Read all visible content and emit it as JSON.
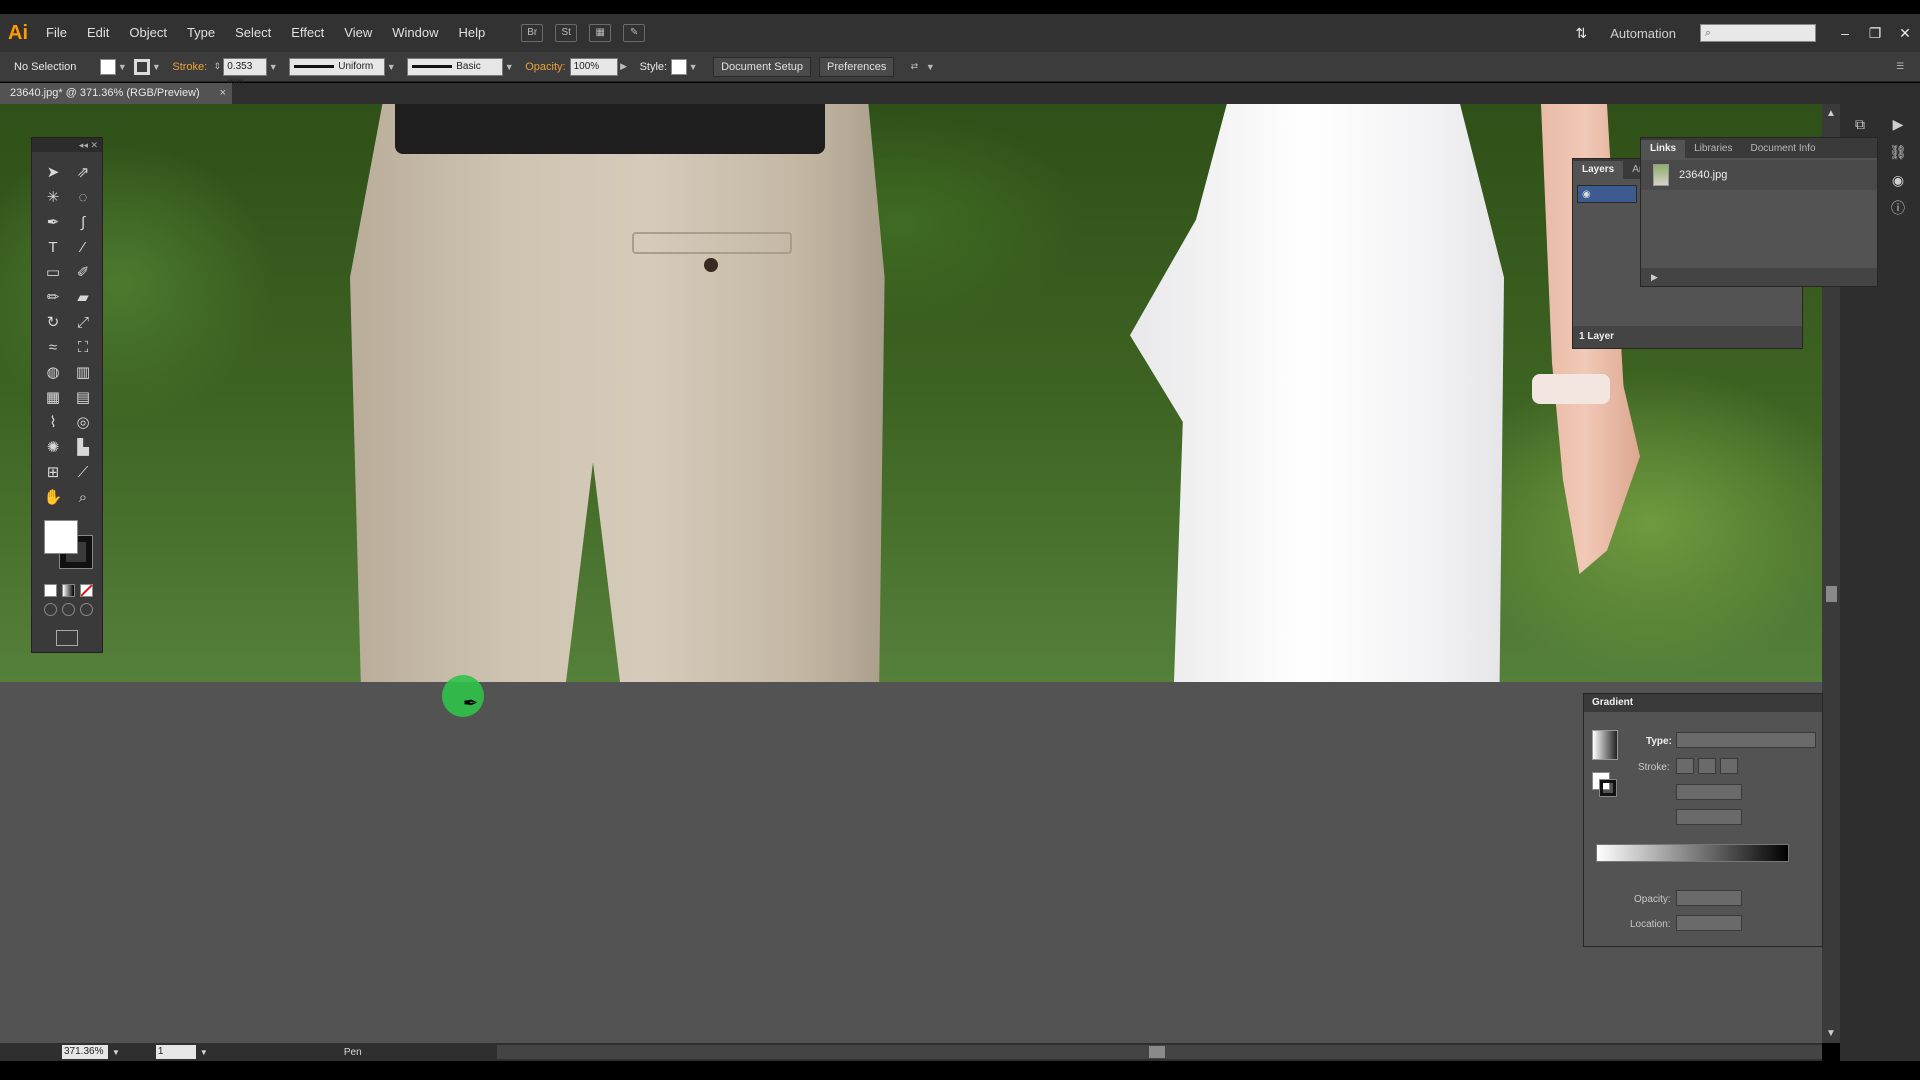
{
  "app": {
    "logo": "Ai",
    "menu": [
      "File",
      "Edit",
      "Object",
      "Type",
      "Select",
      "Effect",
      "View",
      "Window",
      "Help"
    ],
    "workspace": "Automation",
    "search_placeholder": ""
  },
  "control_bar": {
    "selection": "No Selection",
    "stroke_label": "Stroke:",
    "stroke_weight": "0.353 mm",
    "stroke_profile": "Uniform",
    "brush": "Basic",
    "opacity_label": "Opacity:",
    "opacity": "100%",
    "style_label": "Style:",
    "document_setup": "Document Setup",
    "preferences": "Preferences"
  },
  "document": {
    "tab_title": "23640.jpg* @ 371.36% (RGB/Preview)",
    "close": "×"
  },
  "status_bar": {
    "zoom": "371.36%",
    "page": "1",
    "current_tool": "Pen"
  },
  "layers_panel": {
    "tabs": [
      "Layers",
      "Art"
    ],
    "footer": "1 Layer"
  },
  "links_panel": {
    "tabs": [
      "Links",
      "Libraries",
      "Document Info"
    ],
    "file_name": "23640.jpg"
  },
  "gradient_panel": {
    "title": "Gradient",
    "type_label": "Type:",
    "stroke_label": "Stroke:",
    "opacity_label": "Opacity:",
    "location_label": "Location:"
  },
  "colors": {
    "accent_orange": "#ff9a00",
    "cursor_green": "#2fc24a"
  }
}
